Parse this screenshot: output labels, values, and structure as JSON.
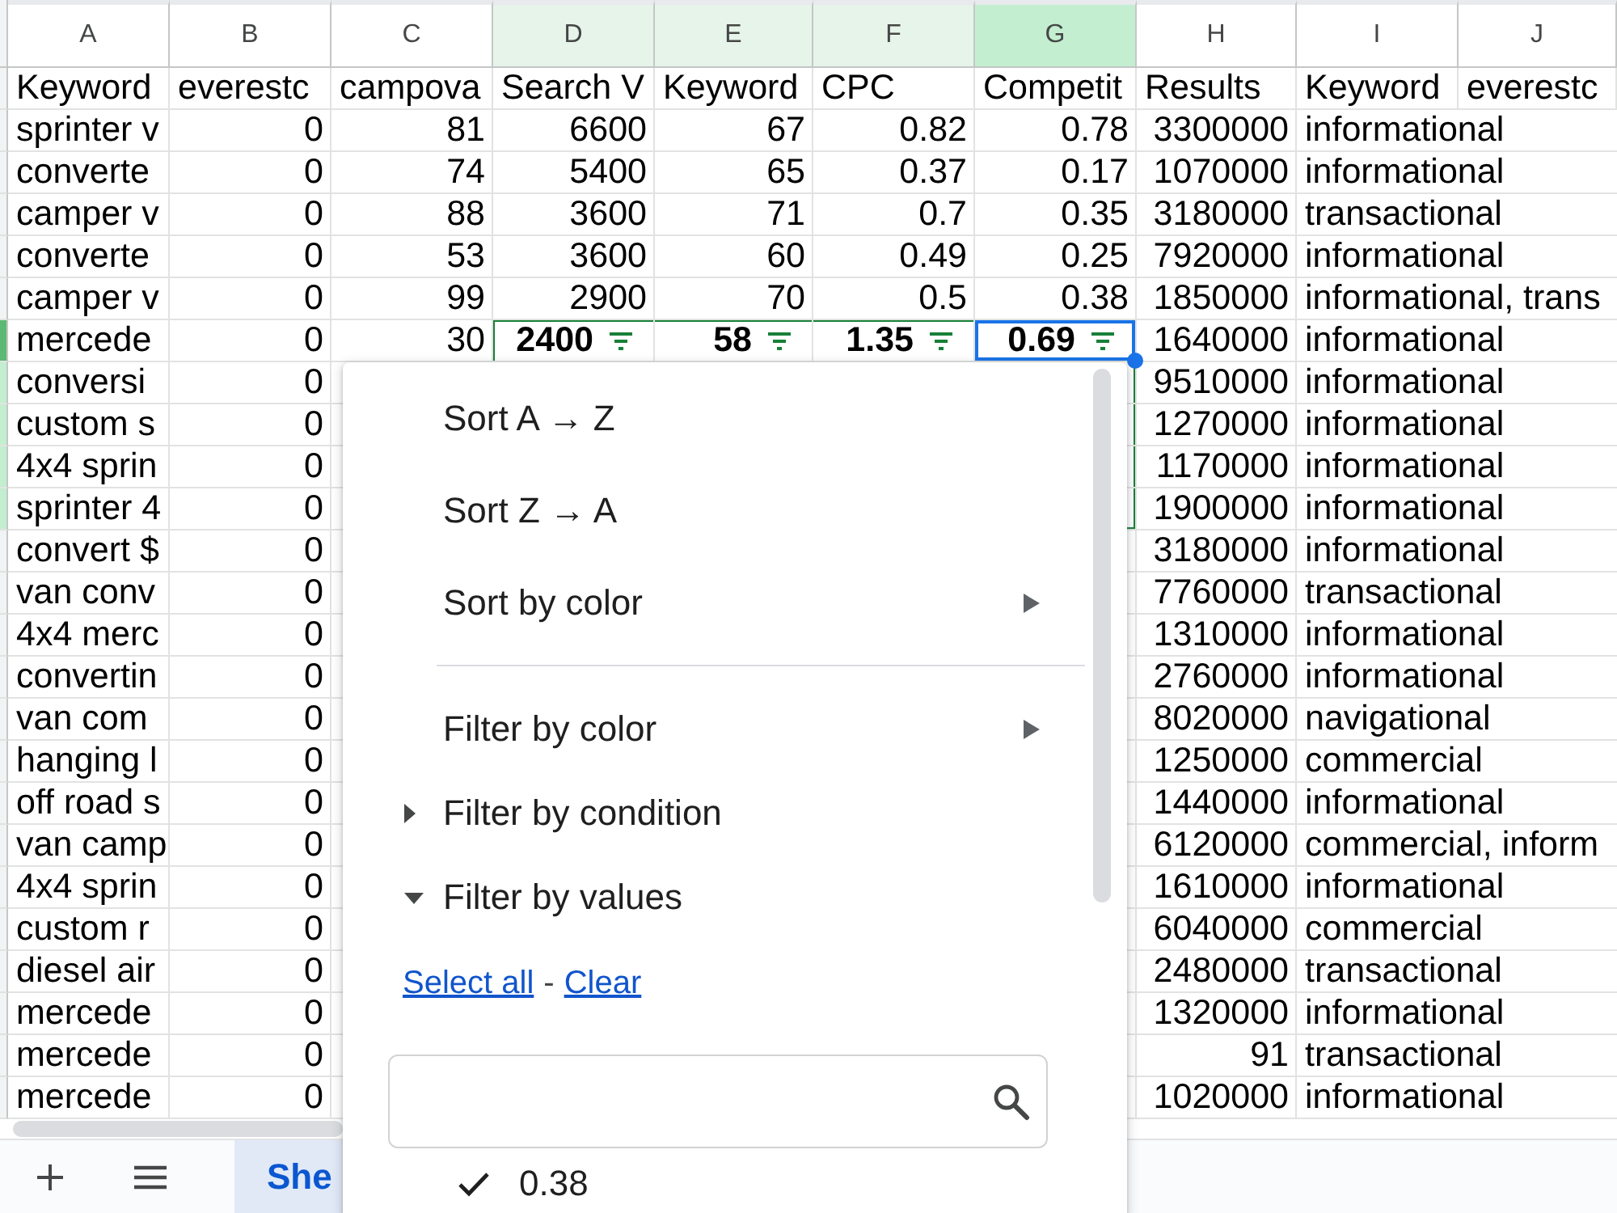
{
  "sheet": {
    "columns": [
      {
        "letter": "A",
        "numeric": false,
        "selected": false,
        "active": false
      },
      {
        "letter": "B",
        "numeric": true,
        "selected": false,
        "active": false
      },
      {
        "letter": "C",
        "numeric": true,
        "selected": false,
        "active": false
      },
      {
        "letter": "D",
        "numeric": true,
        "selected": true,
        "active": false
      },
      {
        "letter": "E",
        "numeric": true,
        "selected": true,
        "active": false
      },
      {
        "letter": "F",
        "numeric": true,
        "selected": true,
        "active": false
      },
      {
        "letter": "G",
        "numeric": true,
        "selected": true,
        "active": true
      },
      {
        "letter": "H",
        "numeric": true,
        "selected": false,
        "active": false
      },
      {
        "letter": "I",
        "numeric": false,
        "selected": false,
        "active": false
      },
      {
        "letter": "J",
        "numeric": false,
        "selected": false,
        "active": false
      }
    ],
    "rows": [
      {
        "kind": "header",
        "selected": false,
        "active": false,
        "cells": [
          "Keyword",
          "everestc",
          "campova",
          "Search V",
          "Keyword",
          "CPC",
          "Competit",
          "Results",
          "Keyword",
          "everestc"
        ]
      },
      {
        "kind": "data",
        "selected": false,
        "active": false,
        "cells": [
          "sprinter v",
          "0",
          "81",
          "6600",
          "67",
          "0.82",
          "0.78",
          "3300000",
          "informational"
        ]
      },
      {
        "kind": "data",
        "selected": false,
        "active": false,
        "cells": [
          "converte",
          "0",
          "74",
          "5400",
          "65",
          "0.37",
          "0.17",
          "1070000",
          "informational"
        ]
      },
      {
        "kind": "data",
        "selected": false,
        "active": false,
        "cells": [
          "camper v",
          "0",
          "88",
          "3600",
          "71",
          "0.7",
          "0.35",
          "3180000",
          "transactional"
        ]
      },
      {
        "kind": "data",
        "selected": false,
        "active": false,
        "cells": [
          "converte",
          "0",
          "53",
          "3600",
          "60",
          "0.49",
          "0.25",
          "7920000",
          "informational"
        ]
      },
      {
        "kind": "data",
        "selected": false,
        "active": false,
        "cells": [
          "camper v",
          "0",
          "99",
          "2900",
          "70",
          "0.5",
          "0.38",
          "1850000",
          "informational, trans"
        ]
      },
      {
        "kind": "filter_header",
        "selected": true,
        "active": true,
        "cells": [
          "mercede",
          "0",
          "30",
          "2400",
          "58",
          "1.35",
          "0.69",
          "1640000",
          "informational"
        ]
      },
      {
        "kind": "data",
        "selected": true,
        "active": false,
        "cells": [
          "conversi",
          "0",
          null,
          null,
          null,
          null,
          null,
          "9510000",
          "informational"
        ]
      },
      {
        "kind": "data",
        "selected": true,
        "active": false,
        "cells": [
          "custom s",
          "0",
          null,
          null,
          null,
          null,
          null,
          "1270000",
          "informational"
        ]
      },
      {
        "kind": "data",
        "selected": true,
        "active": false,
        "cells": [
          "4x4 sprin",
          "0",
          null,
          null,
          null,
          null,
          null,
          "1170000",
          "informational"
        ]
      },
      {
        "kind": "data",
        "selected": true,
        "active": false,
        "cells": [
          "sprinter 4",
          "0",
          null,
          null,
          null,
          null,
          null,
          "1900000",
          "informational"
        ]
      },
      {
        "kind": "data",
        "selected": false,
        "active": false,
        "cells": [
          "convert $",
          "0",
          null,
          null,
          null,
          null,
          null,
          "3180000",
          "informational"
        ]
      },
      {
        "kind": "data",
        "selected": false,
        "active": false,
        "cells": [
          "van conv",
          "0",
          null,
          null,
          null,
          null,
          null,
          "7760000",
          "transactional"
        ]
      },
      {
        "kind": "data",
        "selected": false,
        "active": false,
        "cells": [
          "4x4 merc",
          "0",
          null,
          null,
          null,
          null,
          null,
          "1310000",
          "informational"
        ]
      },
      {
        "kind": "data",
        "selected": false,
        "active": false,
        "cells": [
          "convertin",
          "0",
          null,
          null,
          null,
          null,
          null,
          "2760000",
          "informational"
        ]
      },
      {
        "kind": "data",
        "selected": false,
        "active": false,
        "cells": [
          "van com",
          "0",
          null,
          null,
          null,
          null,
          null,
          "8020000",
          "navigational"
        ]
      },
      {
        "kind": "data",
        "selected": false,
        "active": false,
        "cells": [
          "hanging l",
          "0",
          null,
          null,
          null,
          null,
          null,
          "1250000",
          "commercial"
        ]
      },
      {
        "kind": "data",
        "selected": false,
        "active": false,
        "cells": [
          "off road s",
          "0",
          null,
          null,
          null,
          null,
          null,
          "1440000",
          "informational"
        ]
      },
      {
        "kind": "data",
        "selected": false,
        "active": false,
        "cells": [
          "van camp",
          "0",
          null,
          null,
          null,
          null,
          null,
          "6120000",
          "commercial, inform"
        ]
      },
      {
        "kind": "data",
        "selected": false,
        "active": false,
        "cells": [
          "4x4 sprin",
          "0",
          null,
          null,
          null,
          null,
          null,
          "1610000",
          "informational"
        ]
      },
      {
        "kind": "data",
        "selected": false,
        "active": false,
        "cells": [
          "custom r",
          "0",
          null,
          null,
          null,
          null,
          null,
          "6040000",
          "commercial"
        ]
      },
      {
        "kind": "data",
        "selected": false,
        "active": false,
        "cells": [
          "diesel air",
          "0",
          null,
          null,
          null,
          null,
          null,
          "2480000",
          "transactional"
        ]
      },
      {
        "kind": "data",
        "selected": false,
        "active": false,
        "cells": [
          "mercede",
          "0",
          null,
          null,
          null,
          null,
          null,
          "1320000",
          "informational"
        ]
      },
      {
        "kind": "data",
        "selected": false,
        "active": false,
        "cells": [
          "mercede",
          "0",
          null,
          null,
          null,
          null,
          null,
          "91",
          "transactional"
        ]
      },
      {
        "kind": "data",
        "selected": false,
        "active": false,
        "cells": [
          "mercede",
          "0",
          null,
          null,
          null,
          null,
          null,
          "1020000",
          "informational"
        ]
      }
    ]
  },
  "filter_menu": {
    "items": [
      {
        "kind": "action",
        "label": "Sort A → Z"
      },
      {
        "kind": "action",
        "label": "Sort Z → A"
      },
      {
        "kind": "submenu",
        "label": "Sort by color"
      },
      {
        "kind": "divider"
      },
      {
        "kind": "submenu",
        "label": "Filter by color"
      },
      {
        "kind": "section",
        "label": "Filter by condition",
        "expanded": false
      },
      {
        "kind": "section",
        "label": "Filter by values",
        "expanded": true
      }
    ],
    "links": [
      "Select all",
      "Clear"
    ],
    "link_separator": "-",
    "values": [
      {
        "label": "0.38",
        "checked": true
      }
    ]
  },
  "sheet_tabs": [
    {
      "label": "She",
      "selected": true
    }
  ]
}
